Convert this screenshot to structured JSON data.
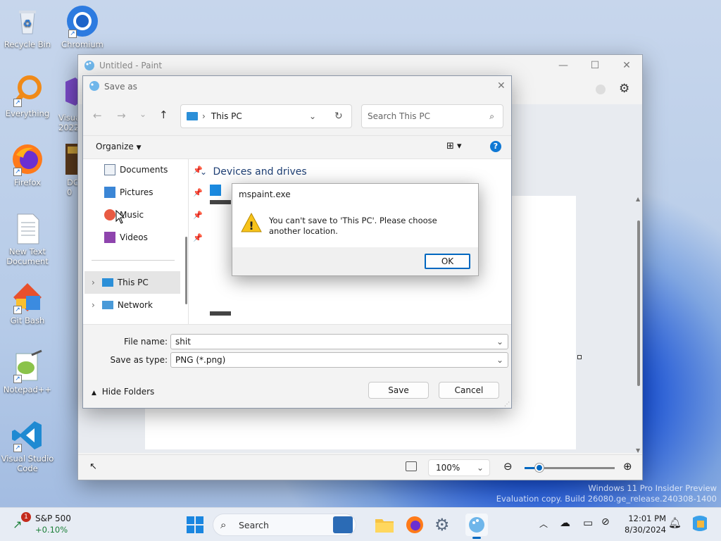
{
  "desktop": {
    "icons": [
      {
        "label": "Recycle Bin"
      },
      {
        "label": "Chromium"
      },
      {
        "label": "Everything"
      },
      {
        "label": "Visual 2022"
      },
      {
        "label": "Firefox"
      },
      {
        "label": "DC 0"
      },
      {
        "label": "New Text Document"
      },
      {
        "label": "Git Bash"
      },
      {
        "label": "Notepad++"
      },
      {
        "label": "Visual Studio Code"
      }
    ],
    "watermark_line1": "Windows 11 Pro Insider Preview",
    "watermark_line2": "Evaluation copy. Build 26080.ge_release.240308-1400"
  },
  "paint": {
    "title": "Untitled - Paint",
    "zoom": "100%",
    "zoom_slider_value": 0.17
  },
  "save_dialog": {
    "title": "Save as",
    "address_location": "This PC",
    "search_placeholder": "Search This PC",
    "organize_label": "Organize",
    "nav_items": [
      {
        "label": "Documents",
        "pinned": true
      },
      {
        "label": "Pictures",
        "pinned": true
      },
      {
        "label": "Music",
        "pinned": true
      },
      {
        "label": "Videos",
        "pinned": true
      },
      {
        "label": "This PC",
        "selected": true
      },
      {
        "label": "Network"
      }
    ],
    "section_header": "Devices and drives",
    "file_name_label": "File name:",
    "file_name_value": "shit",
    "save_type_label": "Save as type:",
    "save_type_value": "PNG (*.png)",
    "hide_folders_label": "Hide Folders",
    "save_button": "Save",
    "cancel_button": "Cancel"
  },
  "message_box": {
    "title": "mspaint.exe",
    "message": "You can't save to 'This PC'. Please choose another location.",
    "ok_button": "OK"
  },
  "taskbar": {
    "widget_title": "S&P 500",
    "widget_value": "+0.10%",
    "widget_badge": "1",
    "search_label": "Search",
    "time": "12:01 PM",
    "date": "8/30/2024"
  },
  "colors": {
    "accent": "#0067c0",
    "selected_nav": "#e5e5e5",
    "warning": "#f7c31a",
    "widget_green": "#1a7f37"
  }
}
